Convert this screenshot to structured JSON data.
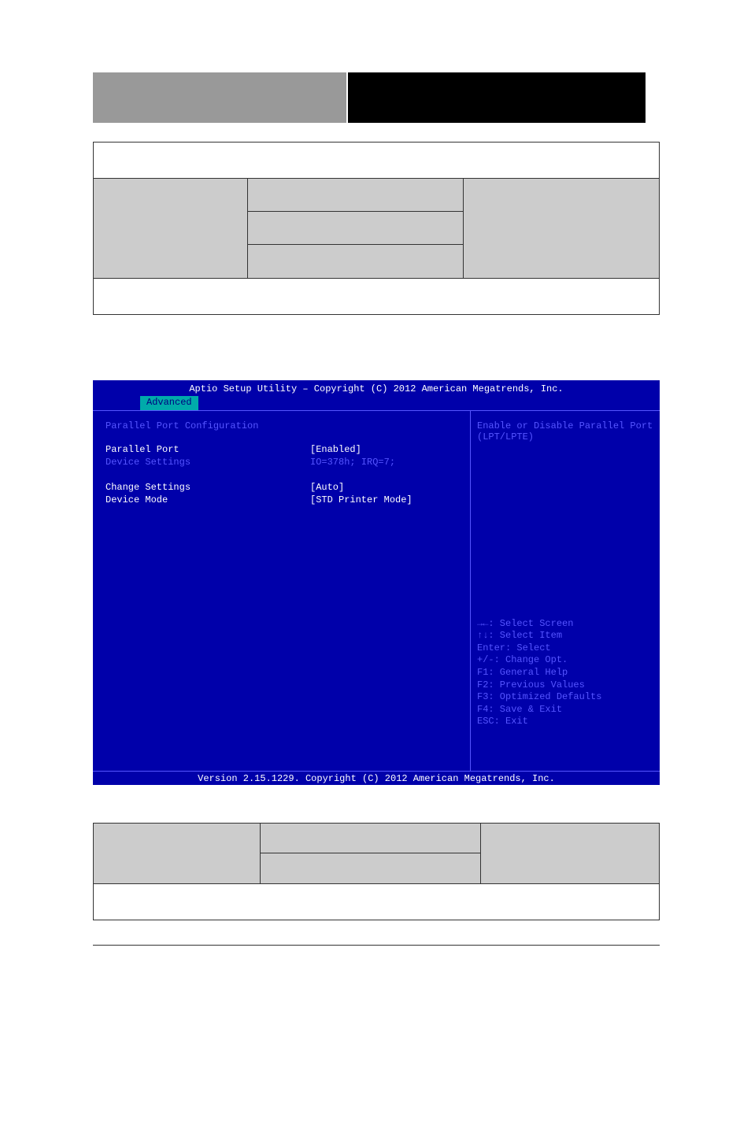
{
  "bios": {
    "header": "Aptio Setup Utility – Copyright (C) 2012 American Megatrends, Inc.",
    "tab": "Advanced",
    "section_title": "Parallel Port Configuration",
    "rows": [
      {
        "label": "Parallel Port",
        "value": "[Enabled]",
        "labelWhite": true,
        "valueWhite": true
      },
      {
        "label": "Device Settings",
        "value": "IO=378h; IRQ=7;",
        "labelWhite": false,
        "valueWhite": false
      }
    ],
    "rows2": [
      {
        "label": "Change Settings",
        "value": "[Auto]",
        "labelWhite": true,
        "valueWhite": true
      },
      {
        "label": "Device Mode",
        "value": "[STD Printer Mode]",
        "labelWhite": true,
        "valueWhite": true
      }
    ],
    "help_text": "Enable or Disable Parallel Port (LPT/LPTE)",
    "keys": [
      "→←: Select Screen",
      "↑↓: Select Item",
      "Enter: Select",
      "+/-: Change Opt.",
      "F1: General Help",
      "F2: Previous Values",
      "F3: Optimized Defaults",
      "F4: Save & Exit",
      "ESC: Exit"
    ],
    "footer": "Version 2.15.1229. Copyright (C) 2012 American Megatrends, Inc."
  }
}
